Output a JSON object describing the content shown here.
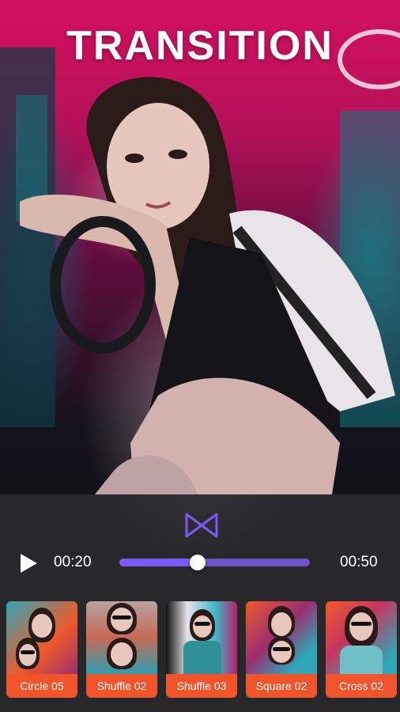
{
  "header": {
    "title": "TRANSITION"
  },
  "player": {
    "current_time": "00:20",
    "total_time": "00:50",
    "progress": 0.41
  },
  "transitions": [
    {
      "label": "Circle 05"
    },
    {
      "label": "Shuffle 02"
    },
    {
      "label": "Shuffle 03"
    },
    {
      "label": "Square 02"
    },
    {
      "label": "Cross 02"
    }
  ],
  "colors": {
    "accent": "#7a5af8",
    "label_bg": "#f1532a",
    "panel": "#2e2e30"
  },
  "icons": [
    "transition-icon",
    "play-icon"
  ]
}
